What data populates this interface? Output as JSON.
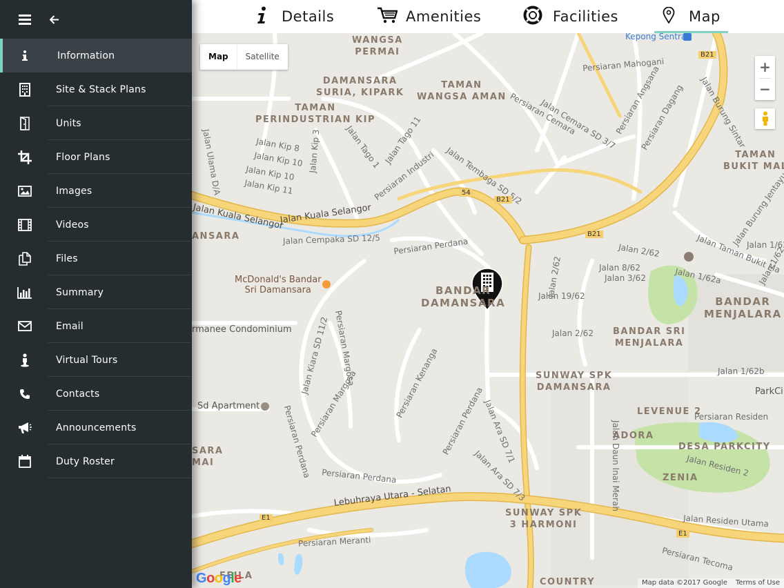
{
  "sidebar": {
    "menu_icon": "hamburger-icon",
    "back_icon": "arrow-left-icon",
    "items": [
      {
        "label": "Information",
        "icon": "info-icon",
        "active": true
      },
      {
        "label": "Site & Stack Plans",
        "icon": "building-icon"
      },
      {
        "label": "Units",
        "icon": "door-icon"
      },
      {
        "label": "Floor Plans",
        "icon": "crop-icon"
      },
      {
        "label": "Images",
        "icon": "image-icon"
      },
      {
        "label": "Videos",
        "icon": "film-icon"
      },
      {
        "label": "Files",
        "icon": "files-icon"
      },
      {
        "label": "Summary",
        "icon": "bar-chart-icon"
      },
      {
        "label": "Email",
        "icon": "envelope-icon"
      },
      {
        "label": "Virtual Tours",
        "icon": "person-icon"
      },
      {
        "label": "Contacts",
        "icon": "phone-icon"
      },
      {
        "label": "Announcements",
        "icon": "megaphone-icon"
      },
      {
        "label": "Duty Roster",
        "icon": "calendar-icon"
      }
    ]
  },
  "tabs": [
    {
      "label": "Details",
      "icon": "info-icon"
    },
    {
      "label": "Amenities",
      "icon": "cart-icon"
    },
    {
      "label": "Facilities",
      "icon": "lifebuoy-icon"
    },
    {
      "label": "Map",
      "icon": "map-pin-icon",
      "active": true
    }
  ],
  "map": {
    "type_buttons": [
      "Map",
      "Satellite"
    ],
    "selected_type": "Map",
    "zoom_in": "+",
    "zoom_out": "−",
    "footer_data": "Map data ©2017 Google",
    "footer_terms": "Terms of Use",
    "logo": "Google",
    "colors": {
      "highway": "#f5cf6e",
      "road": "#ffffff",
      "water": "#aadaff",
      "park": "#c5e3a7",
      "land": "#ebe9e4",
      "marker": "#111111"
    },
    "labels": {
      "wangsa_permai": "WANGSA\nPERMAI",
      "damansara_suria": "DAMANSARA\nSURIA, KIPARK",
      "taman_wangsa_aman": "TAMAN\nWANGSA AMAN",
      "taman_perindustrian": "TAMAN\nPERINDUSTRIAN KIP",
      "bandar_damansara": "BANDAR\nDAMANSARA",
      "bandar_menjalara": "BANDAR\nMENJALARA",
      "bandar_sri_menjalara": "BANDAR SRI\nMENJALARA",
      "sunway_spk": "SUNWAY SPK\nDAMANSARA",
      "sunway_harmoni": "SUNWAY SPK\n3 HARMONI",
      "levenue": "LEVENUE 2",
      "adora": "ADORA",
      "desa_parkcity": "DESA PARKCITY",
      "zenia": "ZENIA",
      "taman_bukit_mal": "TAMAN\nBUKIT MAL",
      "country": "COUNTRY",
      "ansara": "ANSARA",
      "sara_mai": "SARA\nMAI",
      "kepong_sentral": "Kepong Sentral",
      "persiaran_mahogani": "Persiaran Mahogani",
      "jalan_kuala_selangor": "Jalan Kuala Selangor",
      "jalan_kuala_selangor2": "Jalan Kuala Selangor",
      "jalan_cempaka": "Jalan Cempaka SD 12/5",
      "persiaran_perdana": "Persiaran Perdana",
      "persiaran_perdana2": "Persiaran Perdana",
      "mcdonalds": "McDonald's Bandar\nSri Damansara",
      "manee": "rmanee Condominium",
      "sd_apartment": "Sd Apartment",
      "lebuhraya": "Lebuhraya Utara - Selatan",
      "persiaran_meranti": "Persiaran Meranti",
      "persiaran_tecoma": "Persiaran Tecoma",
      "jalan_1_62b": "Jalan 1/62b",
      "jalan_1_62a": "Jalan 1/62a",
      "jalan_2_62": "Jalan 2/62",
      "jalan_19_62": "Jalan 19/62",
      "jalan_8_62": "Jalan 8/62",
      "jalan_3_62": "Jalan 3/62",
      "jalan_2_62b": "Jalan 2/62",
      "jalan_2_62c": "Jalan 2/62",
      "jalan_residen": "Persiaran Residen",
      "jalan_residen2": "Jalan Residen 2",
      "jalan_residen_utama": "Jalan Residen Utama",
      "persiaran_kenanga": "Persiaran Kenanga",
      "persiaran_margosa": "Persiaran Margosa",
      "persiaran_margosa2": "Persiaran Margosa",
      "jalan_kiara": "Jalan Kiara SD 11/2",
      "jalan_ara": "Jalan Ara SD 7/1",
      "jalan_ara2": "Jalan Ara SD 7/3",
      "jalan_daun": "Jalan Daun Inai Merah",
      "persiaran_perdana3": "Persiaran Perdana",
      "persiaran_perdana4": "Persiaran Perdana",
      "persiaran_perdana5": "Persiaran Perdana",
      "persiaran_cemara": "Persiaran Cemara",
      "jalan_cemara": "Jalan Cemara SD 3/7",
      "persiaran_angsana": "Persiaran Angsana",
      "persiaran_dagang": "Persiaran Dagang",
      "jalan_tembaga": "Jalan Tembaga SD 5/2",
      "persiaran_industri": "Persiaran Industri",
      "jalan_tago1": "Jalan Tago 1",
      "jalan_tago11": "Jalan Tago 11",
      "jalan_kip3": "Jalan Kip 3",
      "jalan_kip8": "Jalan Kip 8",
      "jalan_kip10": "Jalan Kip 10",
      "jalan_kip10b": "Jalan Kip 10",
      "jalan_kip11": "Jalan Kip 11",
      "jalan_ulama": "Jalan Ulama D/A",
      "jalan_taman_bukit": "Jalan Taman Bukit Ma",
      "jalan_burung_jentayu": "Jalan Burung Jentayu",
      "jalan_burung_sintar": "Jalan Burung Sintar",
      "jalan_1_62_right": "Jalan 1/62",
      "jalan_1_62_right2": "Jalan 1/62",
      "parkci": "ParkCi",
      "b21a": "B21",
      "b21b": "B21",
      "b21c": "B21",
      "s54": "54",
      "e1a": "E1",
      "e1b": "E1",
      "feila": "FEILA"
    }
  }
}
